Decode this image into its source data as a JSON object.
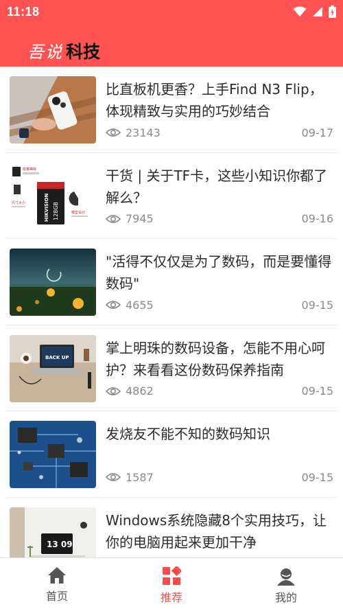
{
  "status_bar": {
    "time": "11:18"
  },
  "brand": {
    "script": "吾说",
    "bold": "科技",
    "color": "#ff5252"
  },
  "articles": [
    {
      "title": "比直板机更香？上手Find N3 Flip，体现精致与实用的巧妙结合",
      "views": "23143",
      "date": "09-17",
      "thumb": "phone-in-hand"
    },
    {
      "title": "干货 | 关于TF卡，这些小知识你都了解么？",
      "views": "7945",
      "date": "09-16",
      "thumb": "tf-card"
    },
    {
      "title": "\"活得不仅仅是为了数码，而是要懂得数码\"",
      "views": "4655",
      "date": "09-15",
      "thumb": "night-field"
    },
    {
      "title": "掌上明珠的数码设备，怎能不用心呵护？来看看这份数码保养指南",
      "views": "4862",
      "date": "09-15",
      "thumb": "laptop-desk"
    },
    {
      "title": "发烧友不能不知的数码知识",
      "views": "1587",
      "date": "09-15",
      "thumb": "circuit-board"
    },
    {
      "title": "Windows系统隐藏8个实用技巧，让你的电脑用起来更加干净",
      "views": "",
      "date": "",
      "thumb": "desk-clock"
    }
  ],
  "thumb_text": {
    "tf_brand": "HIKVISION",
    "tf_capacity": "128GB",
    "tf_label_top": "容量等级",
    "tf_label_size": "尺寸大小",
    "tf_label_design": "模型设计",
    "laptop_screen": "BACK UP",
    "clock_time": "13 09"
  },
  "tabbar": {
    "active": "tab-rec",
    "home_label": "首页",
    "rec_label": "推荐",
    "me_label": "我的",
    "active_color": "#ff4a4a"
  }
}
